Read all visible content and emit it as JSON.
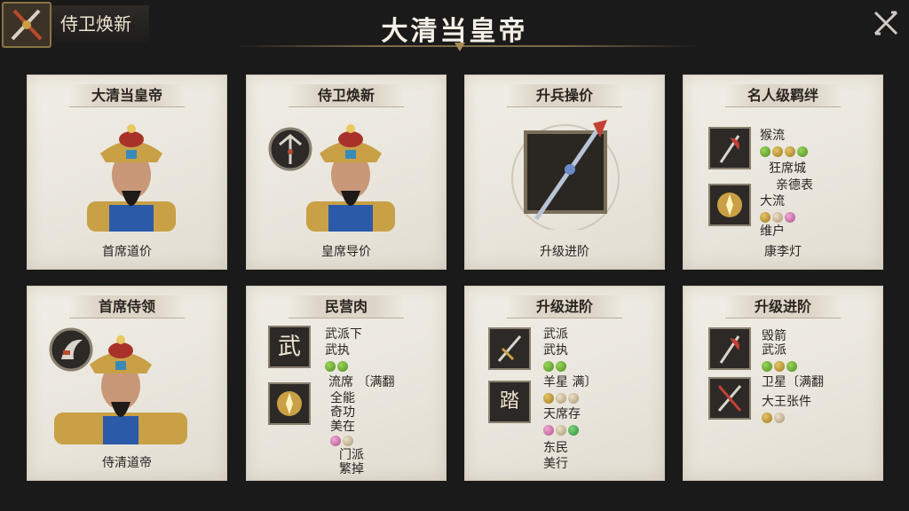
{
  "header": {
    "tab_label": "侍卫焕新",
    "title": "大清当皇帝",
    "tab_icon": "crossed-weapons-icon",
    "close_icon": "close-icon"
  },
  "cards": [
    {
      "title": "大清当皇帝",
      "footer": "首席道价"
    },
    {
      "title": "侍卫焕新",
      "footer": "皇席导价",
      "badge_icon": "trident-icon"
    },
    {
      "title": "升兵操价",
      "footer": "升级进阶",
      "weapon_icon": "spear-icon"
    },
    {
      "title": "名人级羁绊",
      "footer": "康李灯",
      "lines": [
        "猴流",
        "狂席城",
        "亲德表",
        "大流",
        "维户"
      ]
    },
    {
      "title": "首席侍领",
      "footer": "侍清道帝",
      "badge_icon": "axe-icon"
    },
    {
      "title": "民营肉",
      "lines": [
        "武派下",
        "武执",
        "流席 〔满翻",
        "全能",
        "奇功",
        "美在",
        "门派",
        "繁掉"
      ],
      "square_label": "武"
    },
    {
      "title": "升级进阶",
      "lines": [
        "武派",
        "武执",
        "羊星 满〕",
        "天席存",
        "东民",
        "美行"
      ],
      "square_label": "踏"
    },
    {
      "title": "升级进阶",
      "lines": [
        "毁箭",
        "武派",
        "卫星〔满翻",
        "大王张件"
      ]
    }
  ],
  "colors": {
    "background": "#1b1a1a",
    "card": "#ece8df",
    "gold": "#c9a045",
    "title_text": "#f4efe6"
  }
}
